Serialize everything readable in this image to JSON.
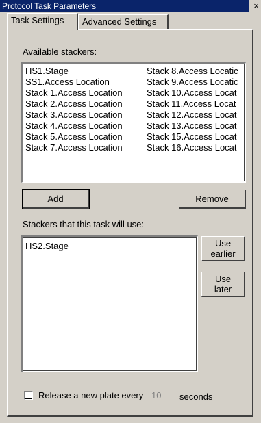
{
  "window": {
    "title": "Protocol Task Parameters",
    "close_glyph": "×"
  },
  "tabs": [
    {
      "label": "Task Settings",
      "active": true
    },
    {
      "label": "Advanced Settings",
      "active": false
    }
  ],
  "available": {
    "label": "Available stackers:",
    "col1": [
      "HS1.Stage",
      "SS1.Access Location",
      "Stack 1.Access Location",
      "Stack 2.Access Location",
      "Stack 3.Access Location",
      "Stack 4.Access Location",
      "Stack 5.Access Location",
      "Stack 7.Access Location"
    ],
    "col2": [
      "Stack 8.Access Locatic",
      "Stack 9.Access Locatic",
      "Stack 10.Access Locat",
      "Stack 11.Access Locat",
      "Stack 12.Access Locat",
      "Stack 13.Access Locat",
      "Stack 15.Access Locat",
      "Stack 16.Access Locat"
    ]
  },
  "buttons": {
    "add": "Add",
    "remove": "Remove",
    "use_earlier_1": "Use",
    "use_earlier_2": "earlier",
    "use_later_1": "Use",
    "use_later_2": "later"
  },
  "used": {
    "label": "Stackers that this task will use:",
    "items": [
      "HS2.Stage"
    ]
  },
  "release": {
    "label": "Release a new plate every",
    "value": "10",
    "unit": "seconds",
    "checked": false
  }
}
